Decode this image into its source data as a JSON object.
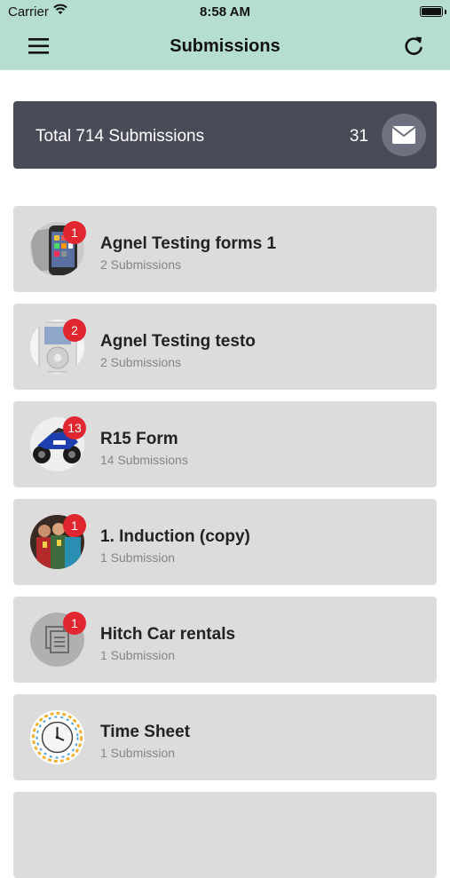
{
  "status_bar": {
    "carrier": "Carrier",
    "time": "8:58 AM"
  },
  "header": {
    "title": "Submissions",
    "menu_icon": "hamburger-menu-icon",
    "refresh_icon": "refresh-icon",
    "background": "#b6ddd2"
  },
  "summary": {
    "label": "Total 714 Submissions",
    "count": "31",
    "icon": "mail-icon",
    "background": "#4a4b59"
  },
  "forms": [
    {
      "title": "Agnel Testing forms 1",
      "subtitle": "2 Submissions",
      "badge": "1",
      "icon": "phone-thumbnail"
    },
    {
      "title": "Agnel Testing testo",
      "subtitle": "2 Submissions",
      "badge": "2",
      "icon": "ipod-thumbnail"
    },
    {
      "title": "R15 Form",
      "subtitle": "14 Submissions",
      "badge": "13",
      "icon": "motorcycle-thumbnail"
    },
    {
      "title": "1. Induction (copy)",
      "subtitle": "1 Submission",
      "badge": "1",
      "icon": "people-thumbnail"
    },
    {
      "title": "Hitch Car rentals",
      "subtitle": "1 Submission",
      "badge": "1",
      "icon": "document-icon"
    },
    {
      "title": "Time Sheet",
      "subtitle": "1 Submission",
      "badge": "",
      "icon": "clock-thumbnail"
    }
  ],
  "colors": {
    "badge": "#e0262e",
    "card": "#dcdcdc",
    "subtitle": "#858585"
  }
}
